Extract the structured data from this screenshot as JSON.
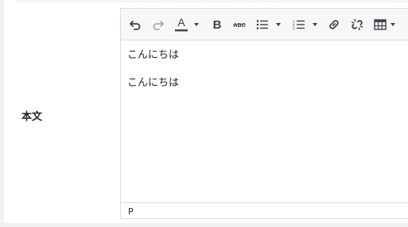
{
  "field": {
    "label": "本文"
  },
  "editor": {
    "paragraphs": [
      "こんにちは",
      "こんにちは"
    ],
    "element_path": "P"
  },
  "toolbar": {
    "buttons": [
      {
        "name": "undo",
        "icon": "undo-icon",
        "enabled": true
      },
      {
        "name": "redo",
        "icon": "redo-icon",
        "enabled": false
      },
      {
        "name": "text-color",
        "icon": "text-color-icon",
        "letter": "A"
      },
      {
        "name": "bold",
        "icon": "bold-icon",
        "letter": "B"
      },
      {
        "name": "strikethrough",
        "icon": "strikethrough-icon",
        "letter": "ABC"
      },
      {
        "name": "bullet-list",
        "icon": "bullet-list-icon"
      },
      {
        "name": "numbered-list",
        "icon": "numbered-list-icon"
      },
      {
        "name": "link",
        "icon": "link-icon"
      },
      {
        "name": "unlink",
        "icon": "unlink-icon"
      },
      {
        "name": "table",
        "icon": "table-icon"
      }
    ]
  },
  "colors": {
    "text_color_underline": "#4a4a4a",
    "toolbar_icon": "#3c434a",
    "disabled_icon": "#a7aaad"
  }
}
